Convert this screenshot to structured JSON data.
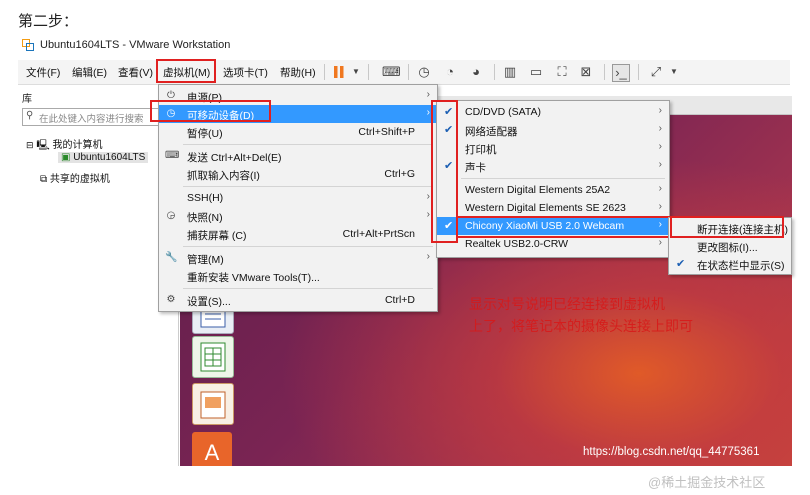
{
  "step_label": "第二步：",
  "window_title": "Ubuntu1604LTS - VMware Workstation",
  "menubar": [
    "文件(F)",
    "编辑(E)",
    "查看(V)",
    "虚拟机(M)",
    "选项卡(T)",
    "帮助(H)"
  ],
  "library": {
    "title": "库",
    "search_placeholder": "在此处键入内容进行搜索",
    "my_computer": "我的计算机",
    "vm_name": "Ubuntu1604LTS",
    "shared": "共享的虚拟机"
  },
  "vm_menu": [
    {
      "label": "电源(P)",
      "shortcut": "",
      "icon": "power-icon",
      "submenu": true
    },
    {
      "label": "可移动设备(D)",
      "shortcut": "",
      "icon": "removable-device-icon",
      "submenu": true,
      "highlight": true
    },
    {
      "label": "暂停(U)",
      "shortcut": "Ctrl+Shift+P",
      "icon": "",
      "submenu": false
    },
    {
      "label": "发送 Ctrl+Alt+Del(E)",
      "shortcut": "",
      "icon": "keyboard-icon",
      "submenu": false
    },
    {
      "label": "抓取输入内容(I)",
      "shortcut": "Ctrl+G",
      "icon": "",
      "submenu": false
    },
    {
      "label": "SSH(H)",
      "shortcut": "",
      "icon": "",
      "submenu": true
    },
    {
      "label": "快照(N)",
      "shortcut": "",
      "icon": "snapshot-icon",
      "submenu": true
    },
    {
      "label": "捕获屏幕 (C)",
      "shortcut": "Ctrl+Alt+PrtScn",
      "icon": "",
      "submenu": false
    },
    {
      "label": "管理(M)",
      "shortcut": "",
      "icon": "wrench-icon",
      "submenu": true
    },
    {
      "label": "重新安装 VMware Tools(T)...",
      "shortcut": "",
      "icon": "",
      "submenu": false
    },
    {
      "label": "设置(S)...",
      "shortcut": "Ctrl+D",
      "icon": "settings-icon",
      "submenu": false
    }
  ],
  "devices_menu": [
    {
      "label": "CD/DVD (SATA)",
      "checked": true
    },
    {
      "label": "网络适配器",
      "checked": true
    },
    {
      "label": "打印机",
      "checked": false
    },
    {
      "label": "声卡",
      "checked": true
    },
    {
      "label": "Western Digital Elements 25A2",
      "checked": false
    },
    {
      "label": "Western Digital Elements SE 2623",
      "checked": false
    },
    {
      "label": "Chicony XiaoMi USB 2.0 Webcam",
      "checked": true,
      "highlight": true
    },
    {
      "label": "Realtek USB2.0-CRW",
      "checked": false
    }
  ],
  "webcam_menu": [
    {
      "label": "断开连接(连接主机)",
      "checked": false
    },
    {
      "label": "更改图标(I)...",
      "checked": false
    },
    {
      "label": "在状态栏中显示(S)",
      "checked": true
    }
  ],
  "annotation_lines": [
    "显示对号说明已经连接到虚拟机",
    "上了，将笔记本的摄像头连接上即可"
  ],
  "watermark_url": "https://blog.csdn.net/qq_44775361",
  "watermark_brand": "@稀土掘金技术社区",
  "colors": {
    "highlight": "#3399ff",
    "annotation_red": "#e02020",
    "pause_orange": "#f07820"
  }
}
